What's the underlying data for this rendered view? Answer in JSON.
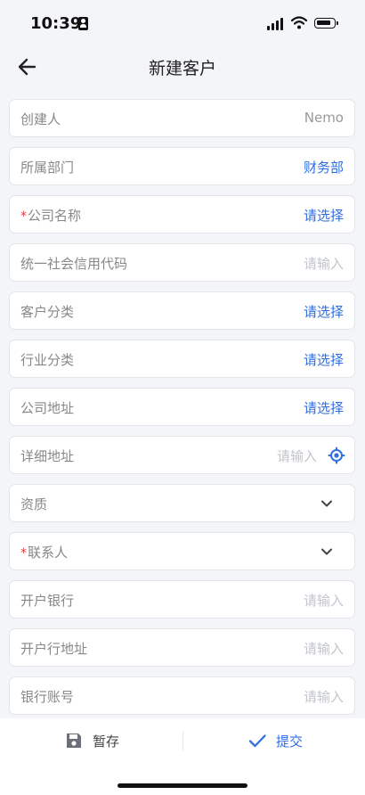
{
  "status_bar": {
    "time": "10:39"
  },
  "header": {
    "title": "新建客户"
  },
  "colors": {
    "accent": "#2f6fe0",
    "required": "#e23b3b",
    "placeholder": "#c2c5cc"
  },
  "form": {
    "creator": {
      "label": "创建人",
      "value": "Nemo"
    },
    "department": {
      "label": "所属部门",
      "value": "财务部"
    },
    "company_name": {
      "label": "公司名称",
      "required_mark": "*",
      "value": "请选择"
    },
    "credit_code": {
      "label": "统一社会信用代码",
      "placeholder": "请输入"
    },
    "customer_category": {
      "label": "客户分类",
      "value": "请选择"
    },
    "industry_category": {
      "label": "行业分类",
      "value": "请选择"
    },
    "company_address": {
      "label": "公司地址",
      "value": "请选择"
    },
    "detail_address": {
      "label": "详细地址",
      "placeholder": "请输入",
      "icon": "location-icon"
    },
    "qualification": {
      "label": "资质",
      "icon": "chevron-down-icon"
    },
    "contact": {
      "label": "联系人",
      "required_mark": "*",
      "icon": "chevron-down-icon"
    },
    "bank": {
      "label": "开户银行",
      "placeholder": "请输入"
    },
    "bank_address": {
      "label": "开户行地址",
      "placeholder": "请输入"
    },
    "bank_account": {
      "label": "银行账号",
      "placeholder": "请输入"
    }
  },
  "footer": {
    "draft_label": "暂存",
    "draft_icon": "save-icon",
    "submit_label": "提交",
    "submit_icon": "check-icon"
  }
}
